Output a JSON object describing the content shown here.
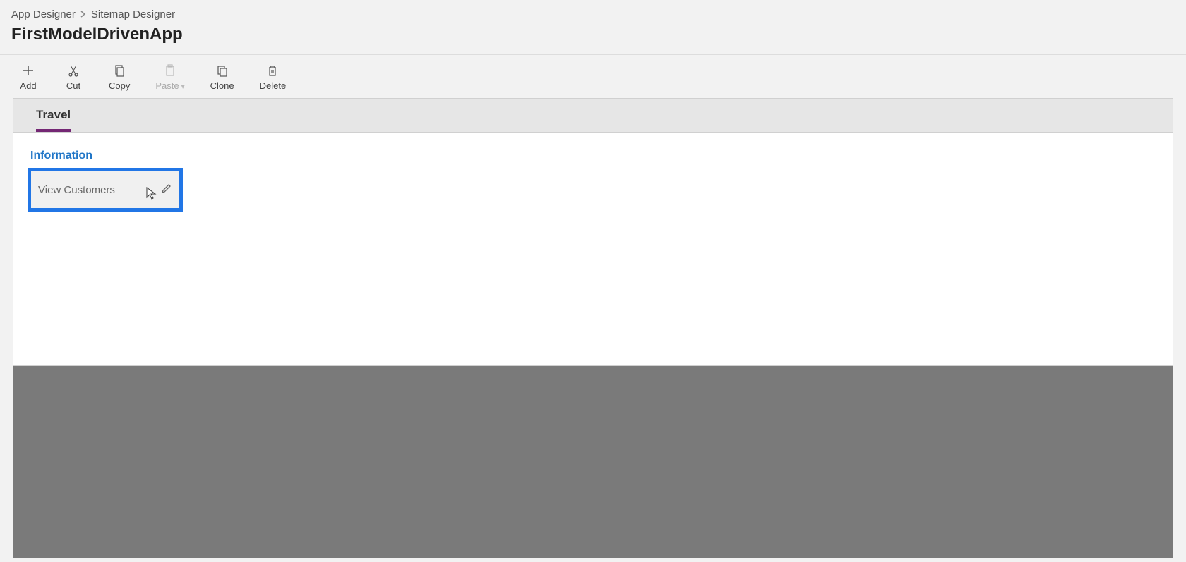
{
  "breadcrumb": {
    "parent": "App Designer",
    "current": "Sitemap Designer"
  },
  "page_title": "FirstModelDrivenApp",
  "toolbar": {
    "add": "Add",
    "cut": "Cut",
    "copy": "Copy",
    "paste": "Paste",
    "clone": "Clone",
    "delete": "Delete"
  },
  "sitemap": {
    "area_tab": "Travel",
    "group_title": "Information",
    "subarea_label": "View Customers"
  },
  "icons": {
    "add": "plus-icon",
    "cut": "cut-icon",
    "copy": "copy-icon",
    "paste": "paste-icon",
    "clone": "clone-icon",
    "delete": "delete-icon",
    "edit": "pencil-icon"
  }
}
